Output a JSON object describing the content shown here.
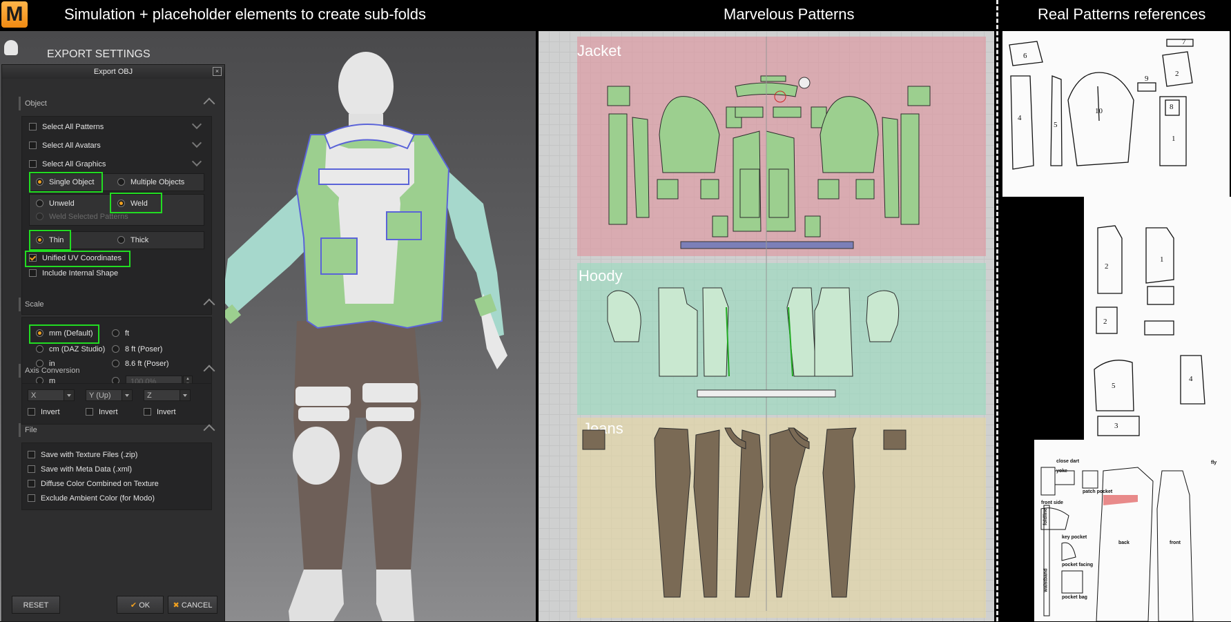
{
  "banner": {
    "logo_letter": "M",
    "left_title": "Simulation + placeholder elements to create sub-folds",
    "middle_title": "Marvelous Patterns",
    "right_title": "Real Patterns references"
  },
  "viewport": {
    "panel_title": "EXPORT SETTINGS"
  },
  "dialog": {
    "title": "Export OBJ",
    "sections": {
      "object": {
        "title": "Object",
        "select_all_patterns": "Select All Patterns",
        "select_all_avatars": "Select All Avatars",
        "select_all_graphics": "Select All Graphics",
        "single_object": "Single Object",
        "multiple_objects": "Multiple Objects",
        "unweld": "Unweld",
        "weld": "Weld",
        "weld_selected": "Weld Selected Patterns",
        "thin": "Thin",
        "thick": "Thick",
        "unified_uv": "Unified UV Coordinates",
        "include_internal": "Include Internal Shape"
      },
      "scale": {
        "title": "Scale",
        "mm": "mm (Default)",
        "ft": "ft",
        "cm": "cm (DAZ Studio)",
        "ft8": "8 ft (Poser)",
        "in": "in",
        "ft86": "8.6 ft (Poser)",
        "m": "m",
        "custom_value": "100.0%"
      },
      "axis": {
        "title": "Axis Conversion",
        "x": "X",
        "y": "Y (Up)",
        "z": "Z",
        "invert": "Invert"
      },
      "file": {
        "title": "File",
        "texture_zip": "Save with Texture Files (.zip)",
        "meta_xml": "Save with Meta Data (.xml)",
        "diffuse": "Diffuse Color Combined on Texture",
        "ambient": "Exclude Ambient Color (for Modo)"
      }
    },
    "buttons": {
      "reset": "RESET",
      "ok": "OK",
      "cancel": "CANCEL"
    },
    "state": {
      "object_mode": "Single Object",
      "weld_mode": "Weld",
      "thickness": "Thin",
      "unified_uv": true,
      "scale": "mm (Default)"
    }
  },
  "patterns": {
    "jacket_label": "Jacket",
    "hoody_label": "Hoody",
    "jeans_label": "Jeans"
  },
  "references": {
    "piece_numbers": [
      "6",
      "7",
      "4",
      "5",
      "10",
      "9",
      "2",
      "8",
      "1",
      "2",
      "1",
      "2",
      "5",
      "4",
      "3"
    ],
    "trouser_labels": [
      "close dart",
      "yoke",
      "front side",
      "patch pocket",
      "key pocket",
      "pocket facing",
      "pocket bag",
      "back",
      "front",
      "fly",
      "waistband",
      "foldline"
    ]
  },
  "colors": {
    "accent_orange": "#f0a020",
    "highlight_green": "#22dd22",
    "jacket_zone": "#d9a3a8",
    "hoody_zone": "#a9dcc4",
    "jeans_zone": "#dcd4b0",
    "jacket_piece": "#9ccf8f",
    "hoody_piece": "#c9e8d0",
    "jeans_piece": "#7a6a55"
  }
}
